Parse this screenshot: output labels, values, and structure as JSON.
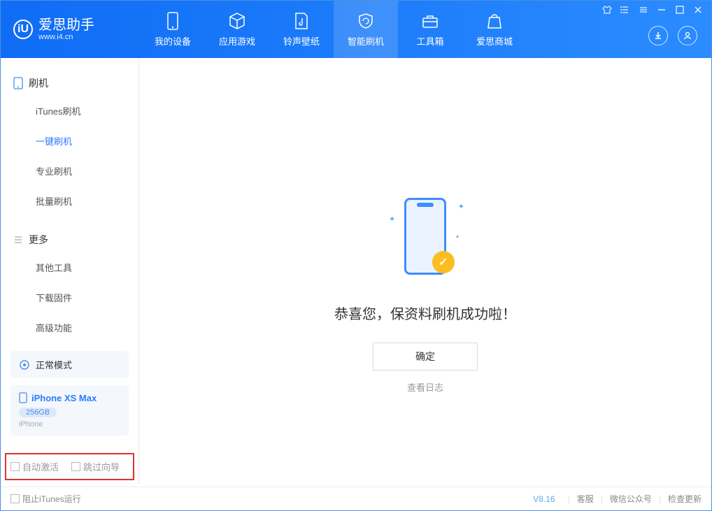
{
  "brand": {
    "name": "爱思助手",
    "url": "www.i4.cn",
    "badge": "iU"
  },
  "tabs": [
    {
      "label": "我的设备"
    },
    {
      "label": "应用游戏"
    },
    {
      "label": "铃声壁纸"
    },
    {
      "label": "智能刷机"
    },
    {
      "label": "工具箱"
    },
    {
      "label": "爱思商城"
    }
  ],
  "sidebar": {
    "group1": "刷机",
    "items1": [
      {
        "label": "iTunes刷机"
      },
      {
        "label": "一键刷机"
      },
      {
        "label": "专业刷机"
      },
      {
        "label": "批量刷机"
      }
    ],
    "group2": "更多",
    "items2": [
      {
        "label": "其他工具"
      },
      {
        "label": "下载固件"
      },
      {
        "label": "高级功能"
      }
    ]
  },
  "mode": {
    "label": "正常模式"
  },
  "device": {
    "name": "iPhone XS Max",
    "storage": "256GB",
    "type": "iPhone"
  },
  "options": {
    "auto_activate": "自动激活",
    "skip_guide": "跳过向导"
  },
  "main": {
    "success": "恭喜您，保资料刷机成功啦！",
    "ok": "确定",
    "view_log": "查看日志"
  },
  "footer": {
    "block_itunes": "阻止iTunes运行",
    "version": "V8.16",
    "support": "客服",
    "wechat": "微信公众号",
    "check_update": "检查更新"
  }
}
